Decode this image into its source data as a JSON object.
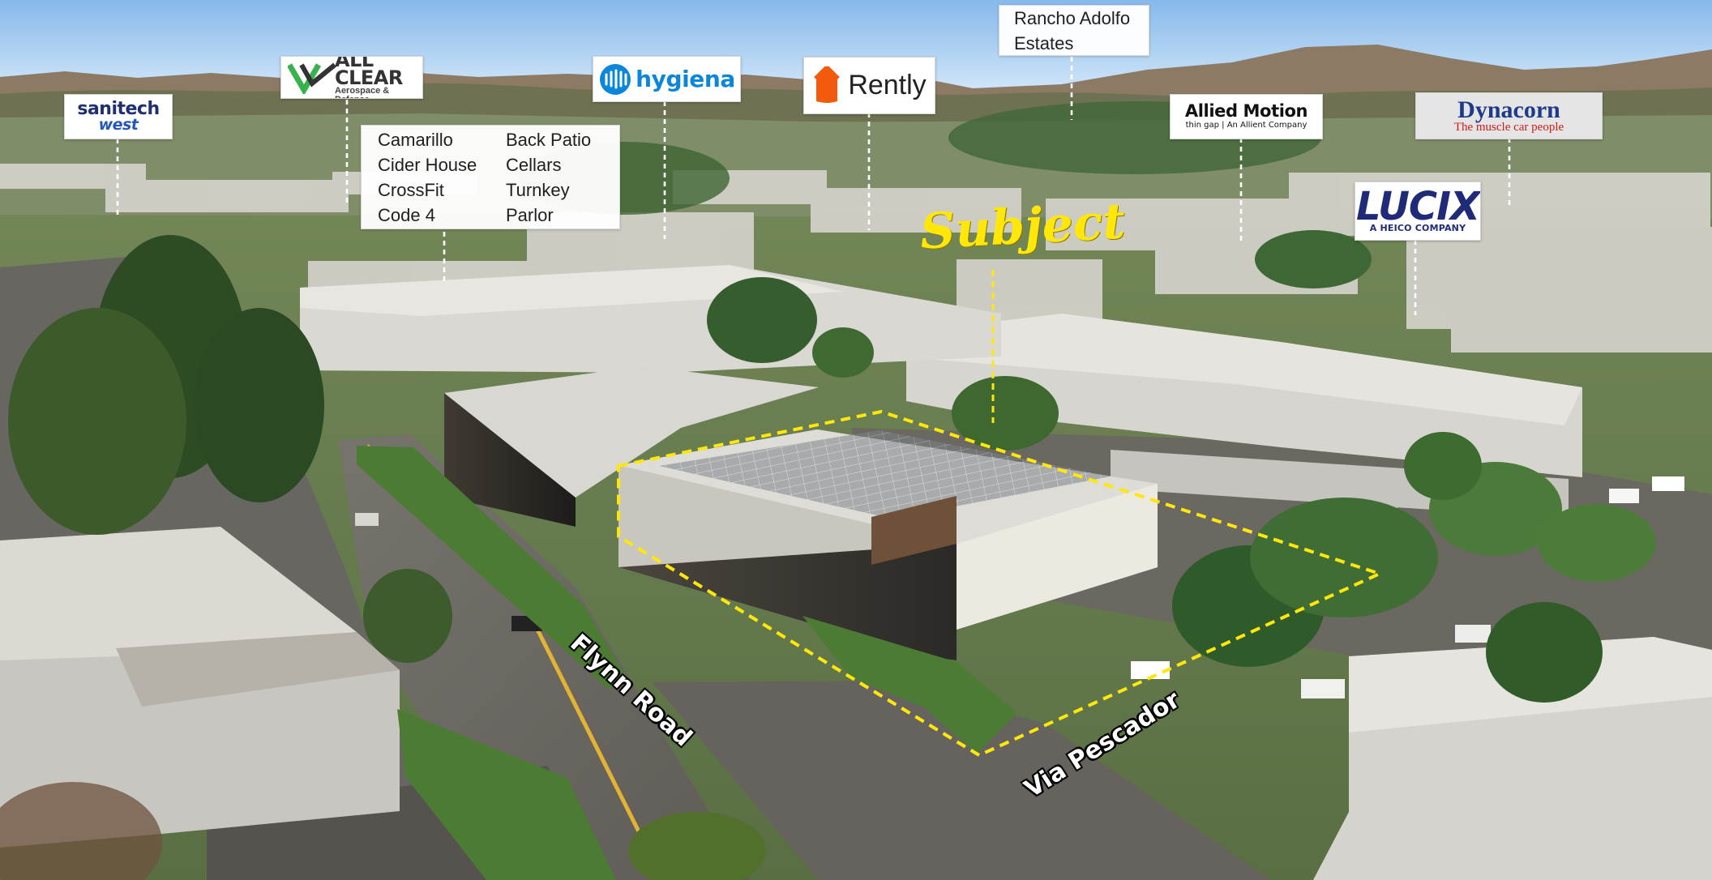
{
  "subject": "Subject",
  "streets": {
    "flynn_road": "Flynn Road",
    "via_pescador": "Via Pescador"
  },
  "neighbors": {
    "sanitech": {
      "line1": "sanitech",
      "line2": "west"
    },
    "all_clear": {
      "line1": "ALL CLEAR",
      "line2": "Aerospace & Defense"
    },
    "restaurants": {
      "left": [
        "Camarillo",
        "Cider House",
        "CrossFit",
        "Code 4"
      ],
      "right": [
        "Back Patio",
        "Cellars",
        "Turnkey",
        "Parlor"
      ]
    },
    "hygiena": "hygiena",
    "rently": "Rently",
    "rancho": {
      "line1": "Rancho Adolfo",
      "line2": "Estates"
    },
    "allied_motion": {
      "line1": "Allied Motion",
      "line2": "thin gap | An Allient Company"
    },
    "dynacorn": {
      "line1": "Dynacorn",
      "line2": "The muscle car people"
    },
    "lucix": {
      "line1": "LUCIX",
      "line2": "A HEICO COMPANY"
    }
  },
  "colors": {
    "sky_top": "#9ec8ef",
    "sky_bottom": "#d8ebfa",
    "mountains": "#8a7b67",
    "subject_outline": "#ffe70a",
    "roof_light": "#d9d7d1",
    "vegetation": "#3c5a2a"
  }
}
